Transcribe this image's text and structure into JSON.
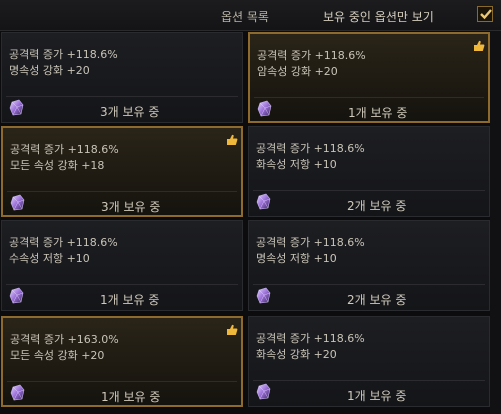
{
  "header": {
    "title": "옵션 목록",
    "toggle_label": "보유 중인 옵션만 보기",
    "toggle_checked": true
  },
  "cards": [
    {
      "line1": "공격력 증가 +118.6%",
      "line2": "명속성 강화 +20",
      "count": "3개 보유 중",
      "selected": false,
      "thumb": false
    },
    {
      "line1": "공격력 증가 +118.6%",
      "line2": "암속성 강화 +20",
      "count": "1개 보유 중",
      "selected": true,
      "thumb": true
    },
    {
      "line1": "공격력 증가 +118.6%",
      "line2": "모든 속성 강화 +18",
      "count": "3개 보유 중",
      "selected": true,
      "thumb": true
    },
    {
      "line1": "공격력 증가 +118.6%",
      "line2": "화속성 저항 +10",
      "count": "2개 보유 중",
      "selected": false,
      "thumb": false
    },
    {
      "line1": "공격력 증가 +118.6%",
      "line2": "수속성 저항 +10",
      "count": "1개 보유 중",
      "selected": false,
      "thumb": false
    },
    {
      "line1": "공격력 증가 +118.6%",
      "line2": "명속성 저항 +10",
      "count": "2개 보유 중",
      "selected": false,
      "thumb": false
    },
    {
      "line1": "공격력 증가 +163.0%",
      "line2": "모든 속성 강화 +20",
      "count": "1개 보유 중",
      "selected": true,
      "thumb": true
    },
    {
      "line1": "공격력 증가 +118.6%",
      "line2": "화속성 강화 +20",
      "count": "1개 보유 중",
      "selected": false,
      "thumb": false
    }
  ],
  "colors": {
    "accent": "#8e6a2c",
    "background": "#0c0c0e",
    "text": "#c9c4b8"
  },
  "icons": {
    "gem": "crystal-gem-icon",
    "thumb": "thumbs-up-icon",
    "check": "checkmark-icon"
  }
}
